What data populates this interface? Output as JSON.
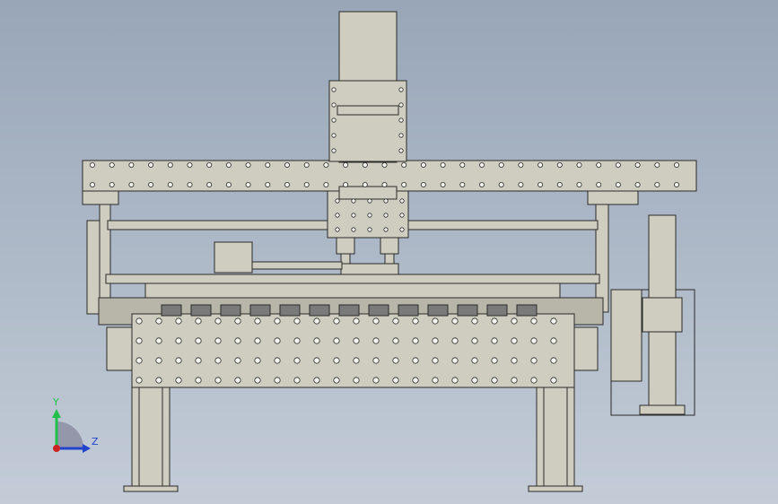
{
  "viewport": {
    "background_top": "#98a6b8",
    "background_bottom": "#c3ccd7"
  },
  "model": {
    "part_fill": "#cfcdc0",
    "part_fill_dark": "#b8b6a9",
    "edge_color": "#2a2a2a",
    "hole_color": "#f4f4ee",
    "motor_fill": "#7a7a7a"
  },
  "triad": {
    "y_label": "Y",
    "z_label": "Z",
    "y_color": "#22c04a",
    "z_color": "#2244cc",
    "x_color": "#cc2222",
    "plane_color": "#8a8aa0"
  }
}
